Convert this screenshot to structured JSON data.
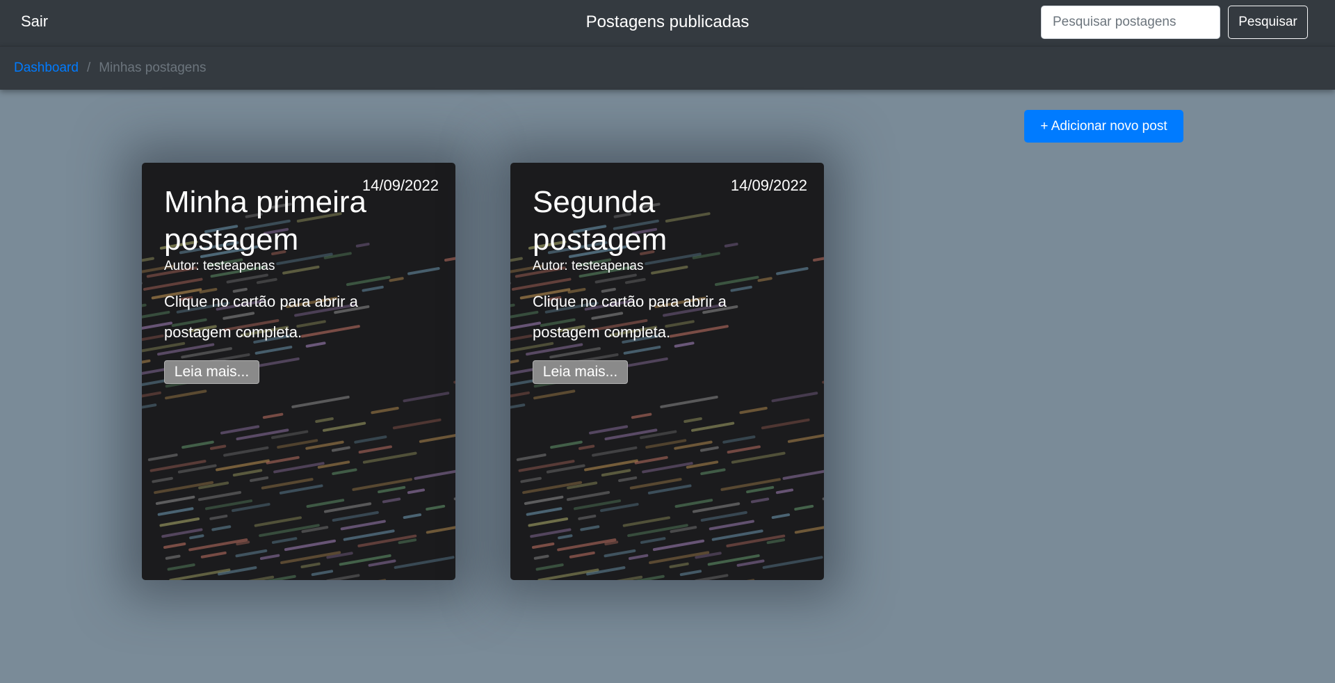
{
  "navbar": {
    "exit_label": "Sair",
    "title": "Postagens publicadas",
    "search_placeholder": "Pesquisar postagens",
    "search_button": "Pesquisar"
  },
  "breadcrumb": {
    "home": "Dashboard",
    "separator": "/",
    "current": "Minhas postagens"
  },
  "add_post_button": "+ Adicionar novo post",
  "posts": [
    {
      "date": "14/09/2022",
      "title": "Minha primeira postagem",
      "author": "Autor: testeapenas",
      "text": "Clique no cartão para abrir a postagem completa.",
      "read_more": "Leia mais..."
    },
    {
      "date": "14/09/2022",
      "title": "Segunda postagem",
      "author": "Autor: testeapenas",
      "text": "Clique no cartão para abrir a postagem completa.",
      "read_more": "Leia mais..."
    }
  ],
  "colors": {
    "page_background": "#7a8b98",
    "navbar": "#343a40",
    "primary": "#007bff",
    "card_background": "#1b1b1d"
  }
}
